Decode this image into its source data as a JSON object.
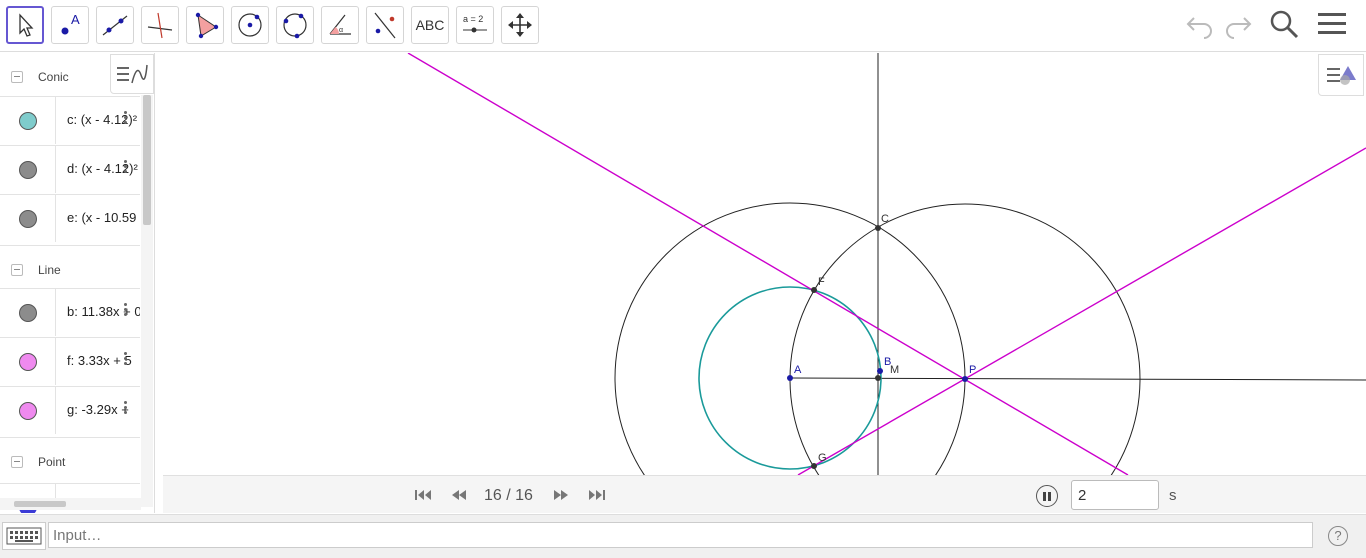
{
  "toolbar": {
    "tools": [
      {
        "name": "move-tool",
        "icon": "cursor-arrow-icon"
      },
      {
        "name": "point-tool",
        "icon": "point-icon",
        "label": "A"
      },
      {
        "name": "line-tool",
        "icon": "line-icon"
      },
      {
        "name": "perpendicular-line-tool",
        "icon": "perpendicular-icon"
      },
      {
        "name": "polygon-tool",
        "icon": "polygon-icon"
      },
      {
        "name": "circle-center-point-tool",
        "icon": "circle-center-icon"
      },
      {
        "name": "circle-three-points-tool",
        "icon": "circle-three-points-icon"
      },
      {
        "name": "angle-tool",
        "icon": "angle-icon"
      },
      {
        "name": "reflect-tool",
        "icon": "reflect-icon"
      },
      {
        "name": "text-tool",
        "icon": "text-icon",
        "label": "ABC"
      },
      {
        "name": "slider-tool",
        "icon": "slider-icon",
        "label": "a = 2"
      },
      {
        "name": "move-graphics-tool",
        "icon": "move-arrows-icon"
      }
    ],
    "right": [
      "undo-icon",
      "redo-icon",
      "search-icon",
      "menu-icon"
    ]
  },
  "algebra": {
    "groups": [
      {
        "title": "Conic",
        "items": [
          {
            "color": "#7fcccc",
            "definition": "c: (x - 4.12)²"
          },
          {
            "color": "#8c8c8c",
            "definition": "d: (x - 4.12)²"
          },
          {
            "color": "#8c8c8c",
            "definition": "e: (x - 10.59"
          }
        ]
      },
      {
        "title": "Line",
        "items": [
          {
            "color": "#8c8c8c",
            "definition": "b: 11.38x + 0"
          },
          {
            "color": "#ef8aef",
            "definition": "f: 3.33x + 5"
          },
          {
            "color": "#ef8aef",
            "definition": "g: -3.29x +"
          }
        ]
      },
      {
        "title": "Point",
        "items": []
      }
    ]
  },
  "graphics": {
    "labels": {
      "A": "A",
      "B": "B",
      "C": "C",
      "F": "F",
      "G": "G",
      "M": "M",
      "P": "P"
    }
  },
  "playbar": {
    "step": "16 / 16",
    "speed": "2",
    "unit": "s"
  },
  "inputbar": {
    "placeholder": "Input…",
    "help": "?"
  }
}
